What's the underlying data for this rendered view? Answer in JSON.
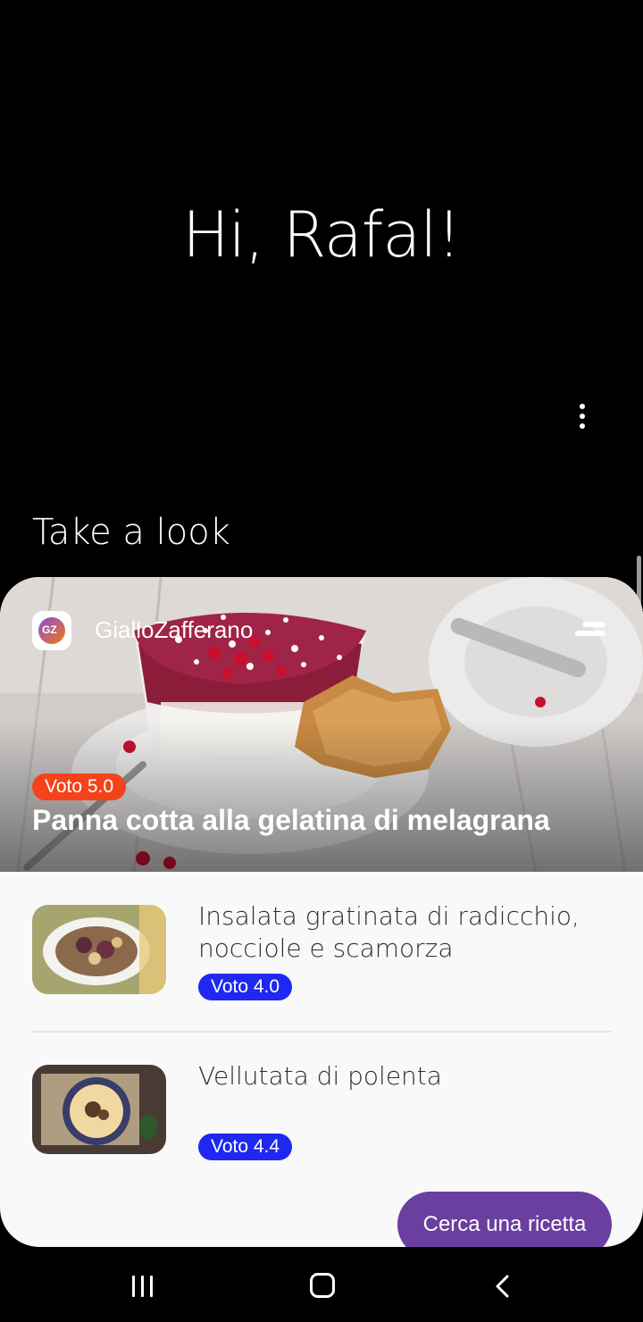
{
  "greeting": "Hi, Rafal!",
  "section_title": "Take a look",
  "card": {
    "app_name": "GialloZafferano",
    "hero": {
      "rating": "Voto 5.0",
      "title": "Panna cotta alla gelatina di melagrana"
    },
    "recipes": [
      {
        "title": "Insalata gratinata di radicchio, nocciole e scamorza",
        "rating": "Voto 4.0"
      },
      {
        "title": "Vellutata di polenta",
        "rating": "Voto 4.4"
      }
    ],
    "search_button": "Cerca una ricetta"
  },
  "colors": {
    "hero_badge": "#f4431a",
    "rating_badge": "#1f28f0",
    "search_button": "#6a3fa0"
  },
  "icons": {
    "more": "more-vertical-icon",
    "menu": "menu-lines-icon",
    "nav_recents": "recents-icon",
    "nav_home": "home-icon",
    "nav_back": "back-icon"
  }
}
